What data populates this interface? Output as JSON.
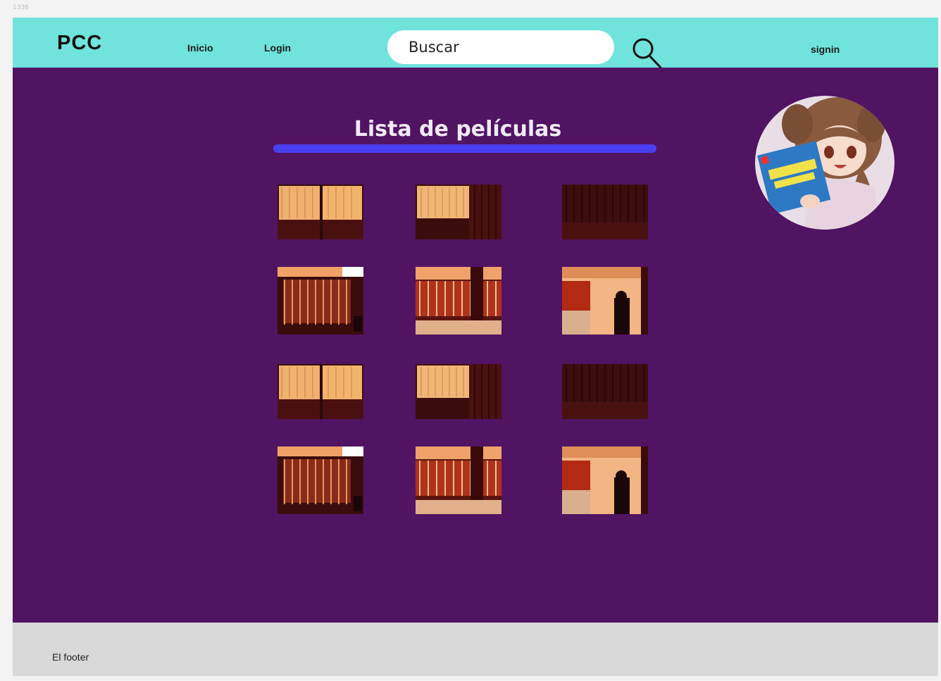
{
  "frame": {
    "label": "1336"
  },
  "header": {
    "logo": "PCC",
    "nav": {
      "inicio": "Inicio",
      "login": "Login",
      "signin": "signin"
    },
    "search": {
      "placeholder": "Buscar"
    }
  },
  "main": {
    "title": "Lista de películas",
    "movies": [
      {
        "variant": "a"
      },
      {
        "variant": "b"
      },
      {
        "variant": "c"
      },
      {
        "variant": "d"
      },
      {
        "variant": "e"
      },
      {
        "variant": "f"
      },
      {
        "variant": "a"
      },
      {
        "variant": "b"
      },
      {
        "variant": "c"
      },
      {
        "variant": "d"
      },
      {
        "variant": "e"
      },
      {
        "variant": "f"
      }
    ]
  },
  "footer": {
    "text": "El footer"
  },
  "colors": {
    "header_bg": "#6fe3dc",
    "main_bg": "#501463",
    "accent_bar": "#4a3ff0",
    "footer_bg": "#d9d9d9"
  }
}
